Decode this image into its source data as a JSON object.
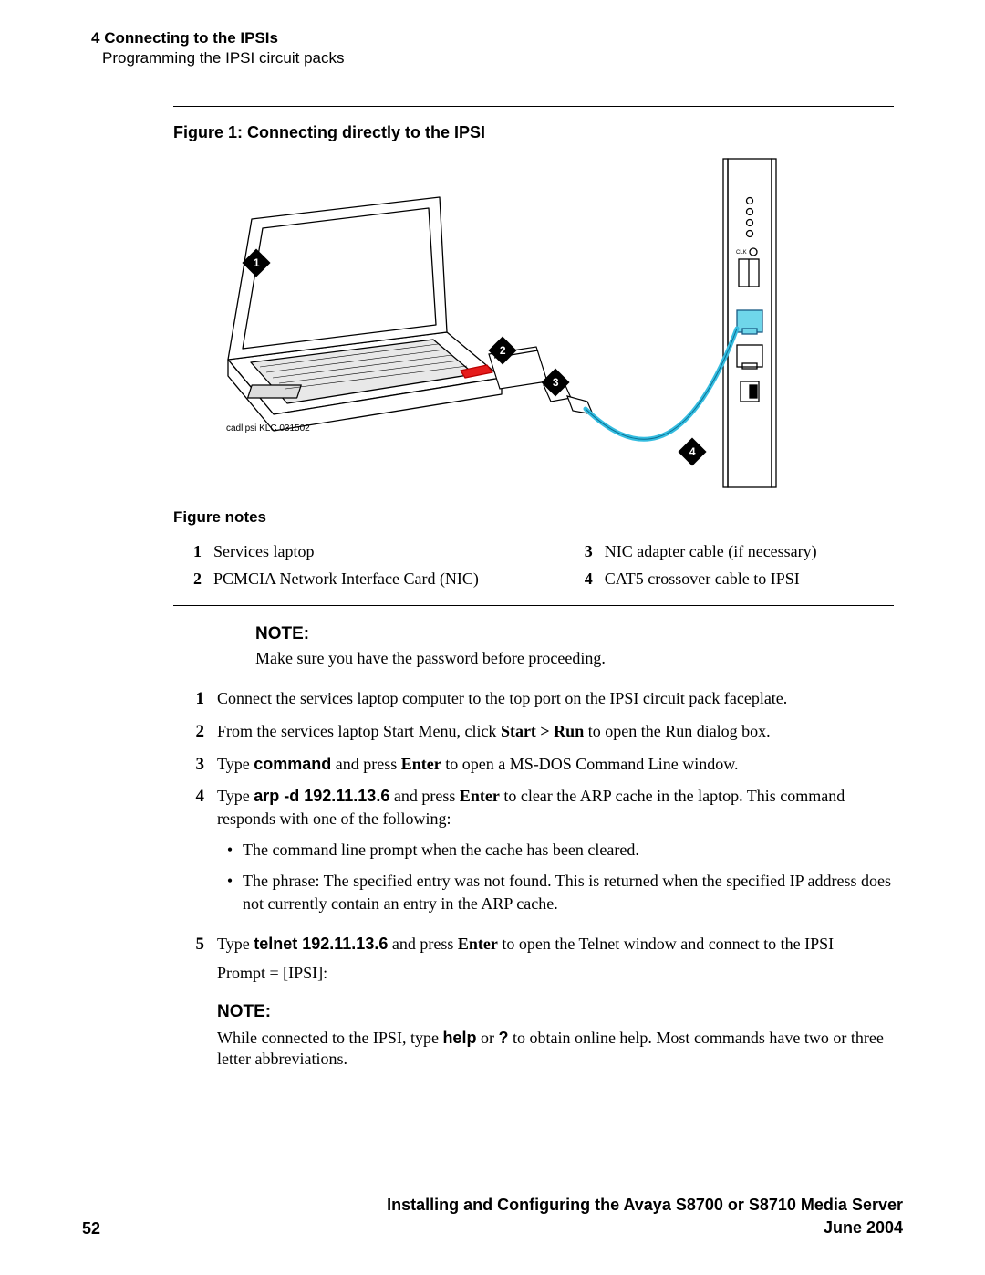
{
  "header": {
    "chapter_num": "4",
    "chapter_title": "Connecting to the IPSIs",
    "subsection": "Programming the IPSI circuit packs"
  },
  "figure": {
    "caption": "Figure 1: Connecting directly to the IPSI",
    "credit": "cadlipsi KLC 031502",
    "callouts": [
      "1",
      "2",
      "3",
      "4"
    ],
    "notes_title": "Figure notes",
    "notes": [
      {
        "n": "1",
        "text": "Services laptop"
      },
      {
        "n": "2",
        "text": "PCMCIA Network Interface Card (NIC)"
      },
      {
        "n": "3",
        "text": "NIC adapter cable (if necessary)"
      },
      {
        "n": "4",
        "text": "CAT5 crossover cable to IPSI"
      }
    ]
  },
  "note1": {
    "label": "NOTE:",
    "body": "Make sure you have the password before proceeding."
  },
  "steps": {
    "s1": "Connect the services laptop computer to the top port on the IPSI circuit pack faceplate.",
    "s2_a": "From the services laptop Start Menu, click ",
    "s2_b": "Start > Run",
    "s2_c": " to open the Run dialog box.",
    "s3_a": "Type ",
    "s3_cmd": "command",
    "s3_b": " and press ",
    "s3_kb": "Enter",
    "s3_c": " to open a MS-DOS Command Line window.",
    "s4_a": "Type ",
    "s4_cmd": "arp -d 192.11.13.6",
    "s4_b": " and press ",
    "s4_kb": "Enter",
    "s4_c": " to clear the ARP cache in the laptop. This command responds with one of the following:",
    "s4_bul1": "The command line prompt when the cache has been cleared.",
    "s4_bul2": "The phrase: The specified entry was not found. This is returned when the specified IP address does not currently contain an entry in the ARP cache.",
    "s5_a": "Type ",
    "s5_cmd": "telnet 192.11.13.6",
    "s5_b": " and press ",
    "s5_kb": "Enter",
    "s5_c": " to open the Telnet window and connect to the IPSI",
    "s5_prompt": "Prompt = [IPSI]:"
  },
  "note2": {
    "label": "NOTE:",
    "a": "While connected to the IPSI, type ",
    "cmd1": "help",
    "b": " or ",
    "cmd2": "?",
    "c": " to obtain online help. Most commands have two or three letter abbreviations."
  },
  "footer": {
    "page": "52",
    "title_line1": "Installing and Configuring the Avaya S8700 or S8710 Media Server",
    "title_line2": "June 2004"
  }
}
